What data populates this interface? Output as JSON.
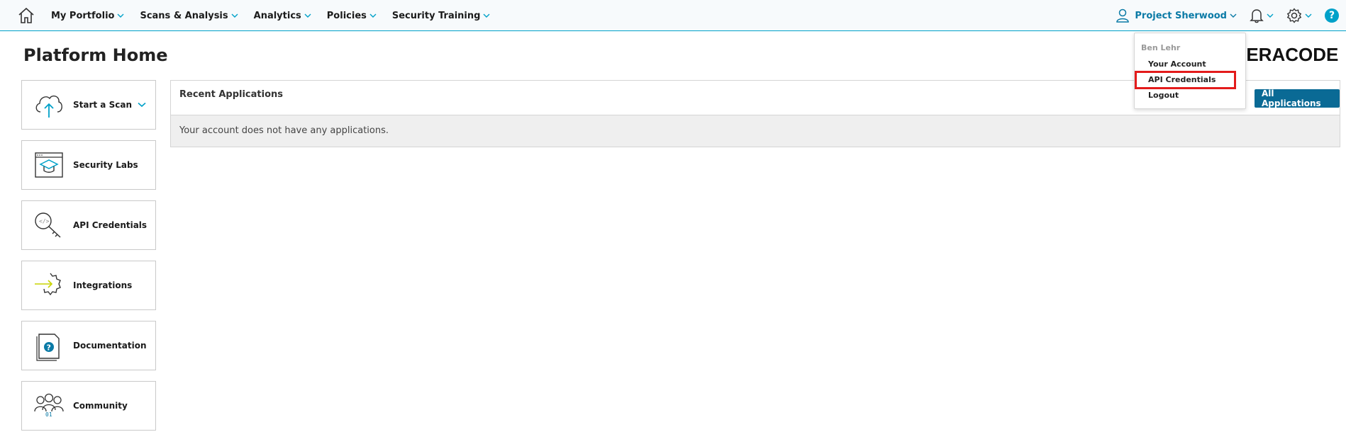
{
  "topbar": {
    "home_icon": "home-icon",
    "nav": [
      {
        "label": "My Portfolio"
      },
      {
        "label": "Scans & Analysis"
      },
      {
        "label": "Analytics"
      },
      {
        "label": "Policies"
      },
      {
        "label": "Security Training"
      }
    ],
    "project_label": "Project Sherwood",
    "icons": [
      "user-icon",
      "bell-icon",
      "gear-icon",
      "help-icon"
    ],
    "help_glyph": "?"
  },
  "page": {
    "title": "Platform Home",
    "logo_text": "VERACODE"
  },
  "tiles": [
    {
      "label": "Start a Scan",
      "icon": "cloud-upload-icon",
      "has_chevron": true
    },
    {
      "label": "Security Labs",
      "icon": "graduation-cap-icon"
    },
    {
      "label": "API Credentials",
      "icon": "key-icon"
    },
    {
      "label": "Integrations",
      "icon": "integration-gear-icon"
    },
    {
      "label": "Documentation",
      "icon": "document-help-icon"
    },
    {
      "label": "Community",
      "icon": "people-icon"
    }
  ],
  "recent": {
    "title": "Recent Applications",
    "button": "All Applications",
    "empty_message": "Your account does not have any applications."
  },
  "dropdown": {
    "user": "Ben Lehr",
    "items": [
      {
        "label": "Your Account"
      },
      {
        "label": "API Credentials",
        "highlighted": true
      },
      {
        "label": "Logout"
      }
    ]
  },
  "colors": {
    "accent": "#00a1c9",
    "button": "#0a6a95",
    "highlight": "#e31b1b"
  }
}
